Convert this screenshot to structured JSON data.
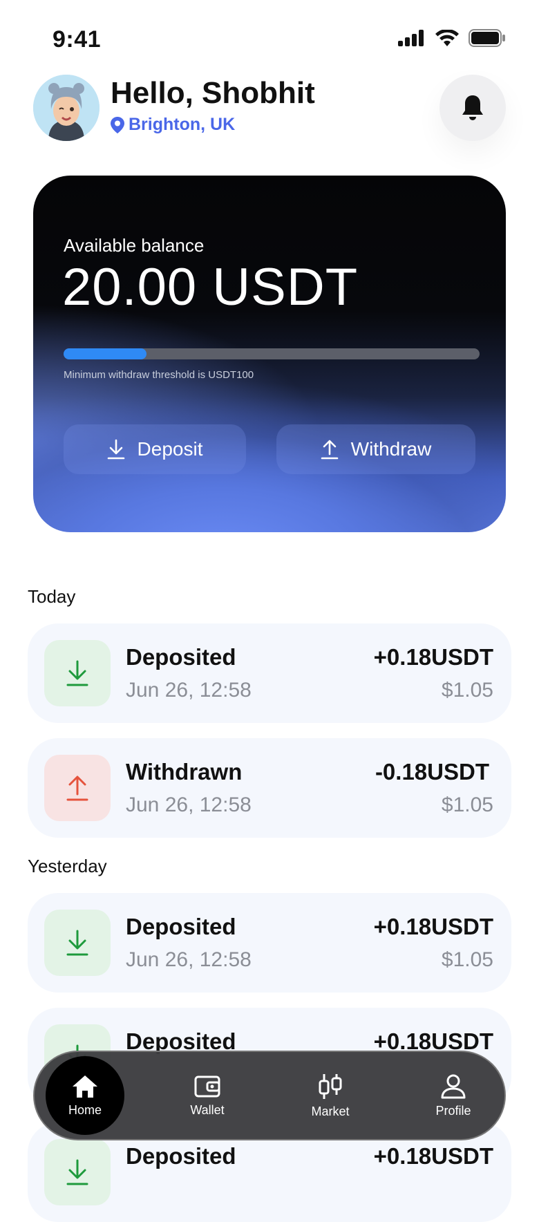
{
  "status_bar": {
    "time": "9:41"
  },
  "header": {
    "greeting": "Hello, Shobhit",
    "location": "Brighton, UK"
  },
  "balance_card": {
    "label": "Available balance",
    "value": "20.00 USDT",
    "progress_fraction": 0.2,
    "threshold_note": "Minimum withdraw threshold is USDT100",
    "deposit_label": "Deposit",
    "withdraw_label": "Withdraw",
    "accent_color": "#2f8af5"
  },
  "sections": [
    {
      "label": "Today",
      "items": [
        {
          "title": "Deposited",
          "date": "Jun 26, 12:58",
          "amount": "+0.18USDT",
          "usd": "$1.05",
          "type": "in"
        },
        {
          "title": "Withdrawn",
          "date": "Jun 26, 12:58",
          "amount": "-0.18USDT",
          "usd": "$1.05",
          "type": "out"
        }
      ]
    },
    {
      "label": "Yesterday",
      "items": [
        {
          "title": "Deposited",
          "date": "Jun 26, 12:58",
          "amount": "+0.18USDT",
          "usd": "$1.05",
          "type": "in"
        },
        {
          "title": "Deposited",
          "date": "",
          "amount": "+0.18USDT",
          "usd": "",
          "type": "in"
        },
        {
          "title": "Deposited",
          "date": "",
          "amount": "+0.18USDT",
          "usd": "",
          "type": "in"
        }
      ]
    }
  ],
  "nav": {
    "items": [
      {
        "label": "Home",
        "icon": "home-icon",
        "active": true
      },
      {
        "label": "Wallet",
        "icon": "wallet-icon",
        "active": false
      },
      {
        "label": "Market",
        "icon": "candlestick-icon",
        "active": false
      },
      {
        "label": "Profile",
        "icon": "user-icon",
        "active": false
      }
    ]
  },
  "colors": {
    "deposit_green": "#1e9a3c",
    "withdraw_red": "#e5533d",
    "location_blue": "#4a67e8"
  }
}
